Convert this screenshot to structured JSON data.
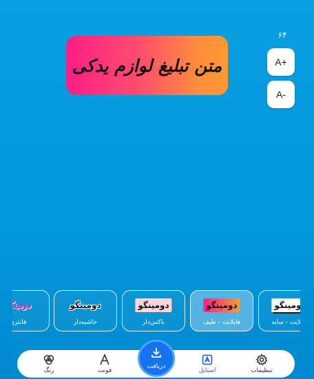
{
  "text_size": {
    "value": "۶۴",
    "increase_label": "A+",
    "decrease_label": "A-"
  },
  "canvas": {
    "text": "متن تبلیغ لوازم یدکی"
  },
  "styles": {
    "items": [
      {
        "preview": "دومینگو",
        "label": "فانتزی"
      },
      {
        "preview": "دومینگو",
        "label": "حاشیه‌دار"
      },
      {
        "preview": "دومینگو",
        "label": "باکس‌دار"
      },
      {
        "preview": "دومینگو",
        "label": "هایلایت - طیف"
      },
      {
        "preview": "دومینگو",
        "label": "هایلایت - سایه"
      }
    ],
    "selected_index": 3
  },
  "nav": {
    "color": "رنگ",
    "font": "فونت",
    "download": "دریافت",
    "style": "استایل",
    "settings": "تنظیمات",
    "active": "style"
  },
  "colors": {
    "background": "#0a9fe2",
    "accent": "#1573f0",
    "gradient_start": "#ff1d86",
    "gradient_end": "#ff9a33"
  },
  "icons": {
    "color": "palette-icon",
    "font": "font-icon",
    "download": "download-icon",
    "style": "style-icon",
    "settings": "gear-icon"
  }
}
